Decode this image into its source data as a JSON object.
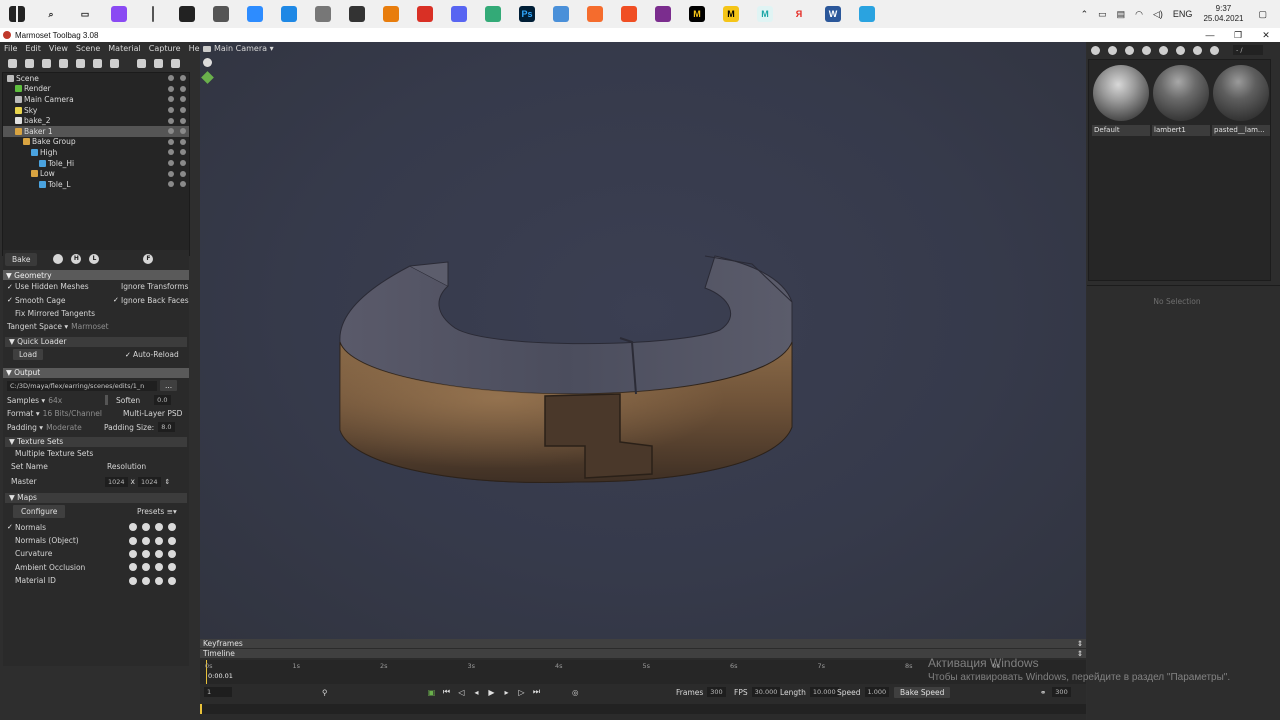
{
  "taskbar": {
    "icons": [
      {
        "name": "windows-start-icon",
        "glyph": "",
        "color": "#f0f0f0",
        "fg": "#222"
      },
      {
        "name": "search-icon",
        "glyph": "⌕",
        "color": "#f0f0f0",
        "fg": "#222"
      },
      {
        "name": "task-view-icon",
        "glyph": "▭",
        "color": "#f0f0f0",
        "fg": "#222"
      },
      {
        "name": "alice-icon",
        "glyph": "",
        "color": "#8a4af3",
        "fg": "#fff"
      },
      {
        "name": "divider-icon",
        "glyph": "",
        "color": "#f0f0f0",
        "fg": "#222"
      },
      {
        "name": "obs-icon",
        "glyph": "",
        "color": "#222",
        "fg": "#fff"
      },
      {
        "name": "zbrush-icon",
        "glyph": "",
        "color": "#555",
        "fg": "#fff"
      },
      {
        "name": "zoom-icon",
        "glyph": "",
        "color": "#2d8cff",
        "fg": "#fff"
      },
      {
        "name": "network-app-icon",
        "glyph": "",
        "color": "#1e88e5",
        "fg": "#fff"
      },
      {
        "name": "zbrush-alt-icon",
        "glyph": "",
        "color": "#777",
        "fg": "#fff"
      },
      {
        "name": "marmoset-icon",
        "glyph": "",
        "color": "#333",
        "fg": "#fff"
      },
      {
        "name": "blender-icon",
        "glyph": "",
        "color": "#e87d0d",
        "fg": "#fff"
      },
      {
        "name": "chrome-icon",
        "glyph": "",
        "color": "#d93025",
        "fg": "#fff"
      },
      {
        "name": "discord-icon",
        "glyph": "",
        "color": "#5865f2",
        "fg": "#fff"
      },
      {
        "name": "pen-app-icon",
        "glyph": "",
        "color": "#3a7",
        "fg": "#fff"
      },
      {
        "name": "photoshop-icon",
        "glyph": "Ps",
        "color": "#001e36",
        "fg": "#31a8ff"
      },
      {
        "name": "image-app-icon",
        "glyph": "",
        "color": "#4a90d9",
        "fg": "#fff"
      },
      {
        "name": "origin-icon",
        "glyph": "",
        "color": "#f56c2d",
        "fg": "#fff"
      },
      {
        "name": "steelseries-icon",
        "glyph": "",
        "color": "#f04e23",
        "fg": "#fff"
      },
      {
        "name": "media-player-icon",
        "glyph": "",
        "color": "#7b2d8e",
        "fg": "#fff"
      },
      {
        "name": "mudbox-icon",
        "glyph": "M",
        "color": "#000",
        "fg": "#f5c518"
      },
      {
        "name": "maya-m-icon",
        "glyph": "M",
        "color": "#f5c518",
        "fg": "#000"
      },
      {
        "name": "maya-icon",
        "glyph": "M",
        "color": "#e0f4f4",
        "fg": "#1aa6a6"
      },
      {
        "name": "yandex-icon",
        "glyph": "Я",
        "color": "#f0f0f0",
        "fg": "#e52620"
      },
      {
        "name": "word-icon",
        "glyph": "W",
        "color": "#2b579a",
        "fg": "#fff"
      },
      {
        "name": "telegram-icon",
        "glyph": "",
        "color": "#2aa3e0",
        "fg": "#fff"
      }
    ],
    "lang": "ENG",
    "time": "9:37",
    "date": "25.04.2021"
  },
  "window": {
    "title": "Marmoset Toolbag 3.08"
  },
  "menu": [
    "File",
    "Edit",
    "View",
    "Scene",
    "Material",
    "Capture",
    "Help"
  ],
  "viewport": {
    "camera_label": "Main Camera ▾"
  },
  "scene_tree": [
    {
      "label": "Scene",
      "indent": 0,
      "color": "#bbbbbb",
      "selected": false
    },
    {
      "label": "Render",
      "indent": 1,
      "color": "#5fbf3f",
      "selected": false
    },
    {
      "label": "Main Camera",
      "indent": 1,
      "color": "#bbbbbb",
      "selected": false
    },
    {
      "label": "Sky",
      "indent": 1,
      "color": "#e8d44d",
      "selected": false
    },
    {
      "label": "bake_2",
      "indent": 1,
      "color": "#e0e0e0",
      "selected": false
    },
    {
      "label": "Baker 1",
      "indent": 1,
      "color": "#d9a441",
      "selected": true
    },
    {
      "label": "Bake Group",
      "indent": 2,
      "color": "#d9a441",
      "selected": false
    },
    {
      "label": "High",
      "indent": 3,
      "color": "#4aa3df",
      "selected": false
    },
    {
      "label": "Tole_Hi",
      "indent": 4,
      "color": "#4aa3df",
      "selected": false
    },
    {
      "label": "Low",
      "indent": 3,
      "color": "#d9a441",
      "selected": false
    },
    {
      "label": "Tole_L",
      "indent": 4,
      "color": "#4aa3df",
      "selected": false
    }
  ],
  "bake": {
    "tab": "Bake",
    "btn_h": "H",
    "btn_l": "L",
    "btn_f": "F",
    "geometry": {
      "header": "▼ Geometry",
      "use_hidden": "Use Hidden Meshes",
      "ignore_transforms": "Ignore Transforms",
      "smooth_cage": "Smooth Cage",
      "ignore_back": "Ignore Back Faces",
      "fix_mirrored": "Fix Mirrored Tangents",
      "tangent_label": "Tangent Space ▾",
      "tangent_value": "Marmoset"
    },
    "quick_loader": {
      "header": "▼ Quick Loader",
      "load": "Load",
      "auto_reload": "Auto-Reload"
    },
    "output": {
      "header": "▼ Output",
      "path": "C:/3D/maya/flex/earring/scenes/edits/1_n",
      "path_btn": "...",
      "samples_label": "Samples ▾",
      "samples_value": "64x",
      "soften_label": "Soften",
      "soften_value": "0.0",
      "format_label": "Format ▾",
      "format_value": "16 Bits/Channel",
      "multilayer": "Multi-Layer PSD",
      "padding_label": "Padding ▾",
      "padding_value": "Moderate",
      "padding_size_label": "Padding Size:",
      "padding_size_value": "8.0"
    },
    "texture_sets": {
      "header": "▼ Texture Sets",
      "multiple": "Multiple Texture Sets",
      "set_name_col": "Set Name",
      "resolution_col": "Resolution",
      "master": "Master",
      "res_w": "1024",
      "res_x": "x",
      "res_h": "1024"
    },
    "maps": {
      "header": "▼ Maps",
      "configure": "Configure",
      "presets": "Presets ≡▾",
      "items": [
        {
          "label": "Normals",
          "checked": "✓"
        },
        {
          "label": "Normals (Object)",
          "checked": ""
        },
        {
          "label": "Curvature",
          "checked": ""
        },
        {
          "label": "Ambient Occlusion",
          "checked": ""
        },
        {
          "label": "Material ID",
          "checked": ""
        }
      ]
    }
  },
  "materials": {
    "search_placeholder": "- /",
    "items": [
      {
        "name": "Default"
      },
      {
        "name": "lambert1"
      },
      {
        "name": "pasted__lam..."
      }
    ],
    "no_selection": "No Selection"
  },
  "timeline": {
    "keyframes": "Keyframes",
    "timeline": "Timeline",
    "current_time": "0:00.01",
    "ticks": [
      "0s",
      "1s",
      "2s",
      "3s",
      "4s",
      "5s",
      "6s",
      "7s",
      "8s",
      "9s"
    ],
    "frame_field": "1",
    "frames_label": "Frames",
    "frames_value": "300",
    "fps_label": "FPS",
    "fps_value": "30.000",
    "length_label": "Length",
    "length_value": "10.000",
    "speed_label": "Speed",
    "speed_value": "1.000",
    "bake_speed": "Bake Speed",
    "end_frame": "300"
  },
  "watermark": {
    "line1": "Активация Windows",
    "line2": "Чтобы активировать Windows, перейдите в раздел \"Параметры\"."
  }
}
